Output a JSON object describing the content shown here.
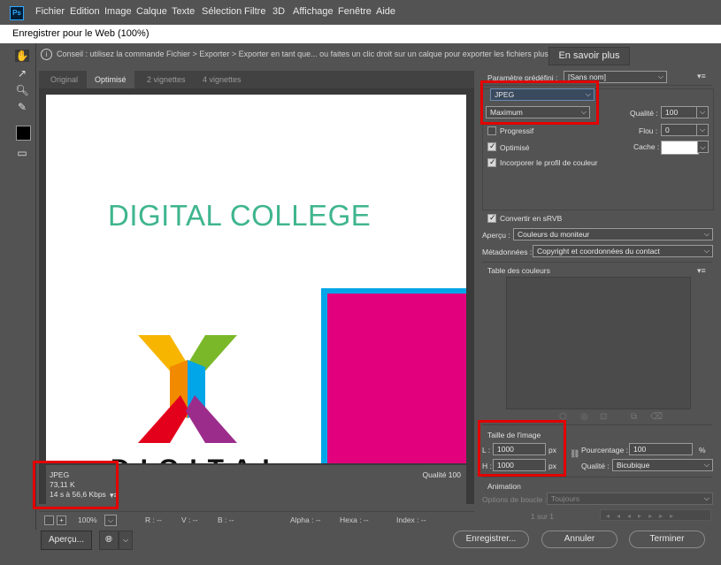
{
  "app": {
    "logo": "Ps",
    "menu": [
      "Fichier",
      "Edition",
      "Image",
      "Calque",
      "Texte",
      "Sélection",
      "Filtre",
      "3D",
      "Affichage",
      "Fenêtre",
      "Aide"
    ]
  },
  "window": {
    "title": "Enregistrer pour le Web (100%)"
  },
  "hint": {
    "text": "Conseil : utilisez la commande Fichier > Exporter > Exporter en tant que... ou faites un clic droit sur un calque pour exporter les fichiers plus rapidement.",
    "learn_more": "En savoir plus"
  },
  "tabs": [
    "Original",
    "Optimisé",
    "2 vignettes",
    "4 vignettes"
  ],
  "preview": {
    "headline": "DIGITAL COLLEGE",
    "partial_text": "DIGITAL"
  },
  "info": {
    "format": "JPEG",
    "size": "73,11 K",
    "time": "14 s à 56,6 Kbps",
    "quality": "Qualité 100"
  },
  "status": {
    "zoom": "100%",
    "r": "R : --",
    "v": "V : --",
    "b": "B : --",
    "alpha": "Alpha : --",
    "hexa": "Hexa : --",
    "index": "Index : --"
  },
  "settings": {
    "preset_label": "Paramètre prédéfini :",
    "preset_value": "[Sans nom]",
    "format": "JPEG",
    "quality_preset": "Maximum",
    "quality_label": "Qualité :",
    "quality_value": "100",
    "progressive": "Progressif",
    "blur_label": "Flou :",
    "blur_value": "0",
    "optimized": "Optimisé",
    "matte_label": "Cache :",
    "embed_profile": "Incorporer le profil de couleur",
    "convert_srgb": "Convertir en sRVB",
    "preview_label": "Aperçu :",
    "preview_value": "Couleurs du moniteur",
    "metadata_label": "Métadonnées :",
    "metadata_value": "Copyright et coordonnées du contact",
    "color_table": "Table des couleurs",
    "image_size": "Taille de l'image",
    "width_label": "L :",
    "width_value": "1000",
    "height_label": "H :",
    "height_value": "1000",
    "unit": "px",
    "percent_label": "Pourcentage :",
    "percent_value": "100",
    "percent_unit": "%",
    "resample_label": "Qualité :",
    "resample_value": "Bicubique",
    "animation": "Animation",
    "loop_label": "Options de boucle :",
    "loop_value": "Toujours",
    "frame_counter": "1 sur 1"
  },
  "buttons": {
    "preview": "Aperçu...",
    "save": "Enregistrer...",
    "cancel": "Annuler",
    "done": "Terminer"
  },
  "colors": {
    "highlight": "#e30000",
    "headline": "#3fb58f",
    "magenta": "#e3007d",
    "cyan": "#00a6e8"
  }
}
